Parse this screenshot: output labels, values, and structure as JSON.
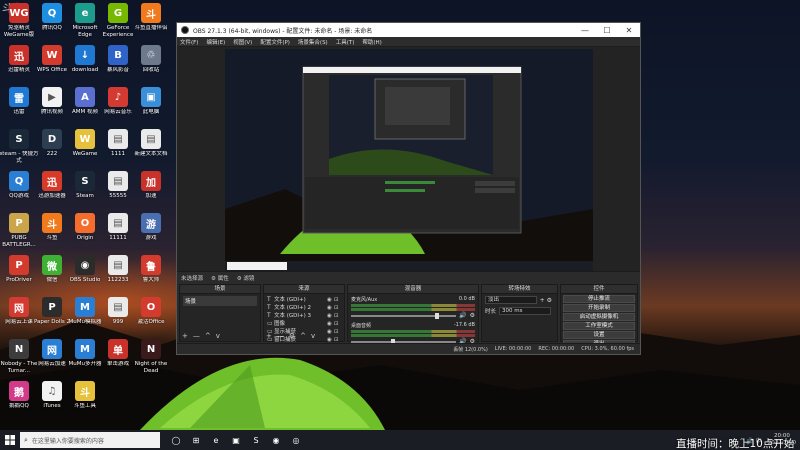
{
  "watermark": "斗鱼",
  "desktop_icons": [
    {
      "label": "免驱精灵 WeGame版",
      "color": "#c8322b",
      "glyph": "WG"
    },
    {
      "label": "腾讯QQ",
      "color": "#1e8fe0",
      "glyph": "Q"
    },
    {
      "label": "Microsoft Edge",
      "color": "#1c9c8c",
      "glyph": "e"
    },
    {
      "label": "GeForce Experience",
      "color": "#76b900",
      "glyph": "G"
    },
    {
      "label": "斗鱼直播伴侣",
      "color": "#f07a1c",
      "glyph": "斗"
    },
    {
      "label": "迅雷精灵",
      "color": "#c8322b",
      "glyph": "迅"
    },
    {
      "label": "WPS Office",
      "color": "#d23b2e",
      "glyph": "W"
    },
    {
      "label": "download",
      "color": "#1f78d1",
      "glyph": "↓"
    },
    {
      "label": "暴风影音",
      "color": "#3063c8",
      "glyph": "B"
    },
    {
      "label": "回收站",
      "color": "#6c7a8c",
      "glyph": "♲"
    },
    {
      "label": "迅雷",
      "color": "#1f78d1",
      "glyph": "雷"
    },
    {
      "label": "腾讯视频",
      "color": "#f2f2f2",
      "glyph": "▶"
    },
    {
      "label": "AMM 视频",
      "color": "#5a6fd0",
      "glyph": "A"
    },
    {
      "label": "网易云音乐",
      "color": "#d33a31",
      "glyph": "♪"
    },
    {
      "label": "此电脑",
      "color": "#3a8fd8",
      "glyph": "▣"
    },
    {
      "label": "steam - 快捷方式",
      "color": "#1b2838",
      "glyph": "S"
    },
    {
      "label": "222",
      "color": "#2c3e50",
      "glyph": "D"
    },
    {
      "label": "WeGame",
      "color": "#e6c23c",
      "glyph": "W"
    },
    {
      "label": "1111",
      "color": "#eaeaea",
      "glyph": "▤"
    },
    {
      "label": "新建文本文档",
      "color": "#eaeaea",
      "glyph": "▤"
    },
    {
      "label": "QQ游戏",
      "color": "#2a7fd4",
      "glyph": "Q"
    },
    {
      "label": "迅游加速器",
      "color": "#d83a2a",
      "glyph": "迅"
    },
    {
      "label": "Steam",
      "color": "#1b2838",
      "glyph": "S"
    },
    {
      "label": "55555",
      "color": "#eaeaea",
      "glyph": "▤"
    },
    {
      "label": "加速",
      "color": "#c8322b",
      "glyph": "加"
    },
    {
      "label": "PUBG BATTLEGR...",
      "color": "#caa54a",
      "glyph": "P"
    },
    {
      "label": "斗鱼",
      "color": "#f07a1c",
      "glyph": "斗"
    },
    {
      "label": "Origin",
      "color": "#f56c2d",
      "glyph": "O"
    },
    {
      "label": "11111",
      "color": "#eaeaea",
      "glyph": "▤"
    },
    {
      "label": "游戏",
      "color": "#4a6fb0",
      "glyph": "游"
    },
    {
      "label": "ProDriver",
      "color": "#d23b2e",
      "glyph": "P"
    },
    {
      "label": "微信",
      "color": "#3eb135",
      "glyph": "微"
    },
    {
      "label": "OBS Studio",
      "color": "#2b2b2b",
      "glyph": "◉"
    },
    {
      "label": "112233",
      "color": "#eaeaea",
      "glyph": "▤"
    },
    {
      "label": "鲁大师",
      "color": "#d23b2e",
      "glyph": "鲁"
    },
    {
      "label": "网易云上课",
      "color": "#d33a31",
      "glyph": "网"
    },
    {
      "label": "Paper Dolls 2",
      "color": "#2c2c2c",
      "glyph": "P"
    },
    {
      "label": "MuMu模拟器",
      "color": "#2a7fd4",
      "glyph": "M"
    },
    {
      "label": "999",
      "color": "#eaeaea",
      "glyph": "▤"
    },
    {
      "label": "激活Office",
      "color": "#d23b2e",
      "glyph": "O"
    },
    {
      "label": "Nobody - The Turnar...",
      "color": "#3c3c3c",
      "glyph": "N"
    },
    {
      "label": "网易云加速",
      "color": "#2a7fd4",
      "glyph": "网"
    },
    {
      "label": "MuMu多开器",
      "color": "#2a7fd4",
      "glyph": "M"
    },
    {
      "label": "单击游戏",
      "color": "#c8322b",
      "glyph": "单"
    },
    {
      "label": "Night of the Dead",
      "color": "#3a1a1a",
      "glyph": "N"
    },
    {
      "label": "鹅鹅QQ",
      "color": "#d23b8a",
      "glyph": "鹅"
    },
    {
      "label": "iTunes",
      "color": "#f2f2f2",
      "glyph": "♫"
    },
    {
      "label": "斗鱼工具",
      "color": "#e6c23c",
      "glyph": "斗"
    }
  ],
  "obs": {
    "title": "OBS 27.1.3 (64-bit, windows) - 配置文件: 未命名 - 场景: 未命名",
    "window_buttons": [
      "—",
      "☐",
      "✕"
    ],
    "menu": [
      "文件(F)",
      "编辑(E)",
      "视图(V)",
      "配置文件(P)",
      "场景集合(S)",
      "工具(T)",
      "帮助(H)"
    ],
    "status_row": [
      "未选择源",
      "⚙ 属性",
      "⚙ 滤镜"
    ],
    "scenes": {
      "title": "场景",
      "items": [
        "场景"
      ],
      "toolbar": [
        "+",
        "—",
        "^",
        "v"
      ]
    },
    "sources": {
      "title": "来源",
      "items": [
        {
          "icon": "T",
          "name": "文本 (GDI+)"
        },
        {
          "icon": "T",
          "name": "文本 (GDI+) 2"
        },
        {
          "icon": "T",
          "name": "文本 (GDI+) 3"
        },
        {
          "icon": "▭",
          "name": "图像"
        },
        {
          "icon": "▭",
          "name": "显示捕获"
        },
        {
          "icon": "▭",
          "name": "窗口捕获"
        }
      ],
      "toolbar": [
        "+",
        "—",
        "⚙",
        "^",
        "v"
      ]
    },
    "mixer": {
      "title": "混音器",
      "channels": [
        {
          "name": "麦克风/Aux",
          "db": "0.0 dB",
          "level": 0.82
        },
        {
          "name": "桌面音频",
          "db": "-17.6 dB",
          "level": 0.4
        }
      ]
    },
    "transitions": {
      "title": "转场特效",
      "type": "淡出",
      "duration_label": "时长",
      "duration": "300 ms"
    },
    "controls": {
      "title": "控件",
      "buttons": [
        "停止推流",
        "开始录制",
        "启动虚拟摄像机",
        "工作室模式",
        "设置",
        "退出"
      ]
    },
    "bottom": [
      "丢帧 12(0.0%)",
      "LIVE: 00:00:00",
      "REC: 00:00:00",
      "CPU: 3.0%, 60.00 fps"
    ]
  },
  "preview_caption": "直播时间",
  "taskbar": {
    "search_placeholder": "在这里输入你要搜索的内容",
    "apps": [
      "◯",
      "⊞",
      "e",
      "▣",
      "S",
      "◉",
      "◎"
    ],
    "tray_icons": "^ 🔊 中",
    "time": "20:00",
    "date": "2022/1/10"
  },
  "overlay_text": "直播时间：晚上10点开始"
}
